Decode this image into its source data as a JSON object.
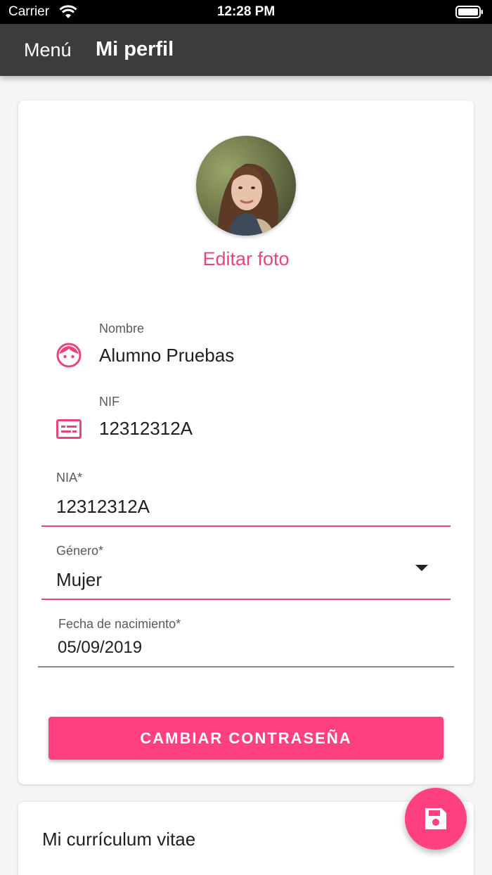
{
  "status_bar": {
    "carrier": "Carrier",
    "time": "12:28 PM"
  },
  "app_bar": {
    "menu_label": "Menú",
    "title": "Mi perfil"
  },
  "profile": {
    "edit_photo_label": "Editar foto",
    "nombre": {
      "label": "Nombre",
      "value": "Alumno Pruebas",
      "icon": "face-icon"
    },
    "nif": {
      "label": "NIF",
      "value": "12312312A",
      "icon": "id-card-icon"
    },
    "nia": {
      "label": "NIA*",
      "value": "12312312A"
    },
    "genero": {
      "label": "Género*",
      "value": "Mujer"
    },
    "fecha_nacimiento": {
      "label": "Fecha de nacimiento*",
      "value": "05/09/2019"
    },
    "change_password_label": "CAMBIAR CONTRASEÑA"
  },
  "cv": {
    "title": "Mi currículum vitae"
  },
  "fab": {
    "icon": "save-icon"
  },
  "colors": {
    "accent": "#ff4081",
    "accent_text": "#e8457e",
    "appbar": "#3c3c3c"
  }
}
